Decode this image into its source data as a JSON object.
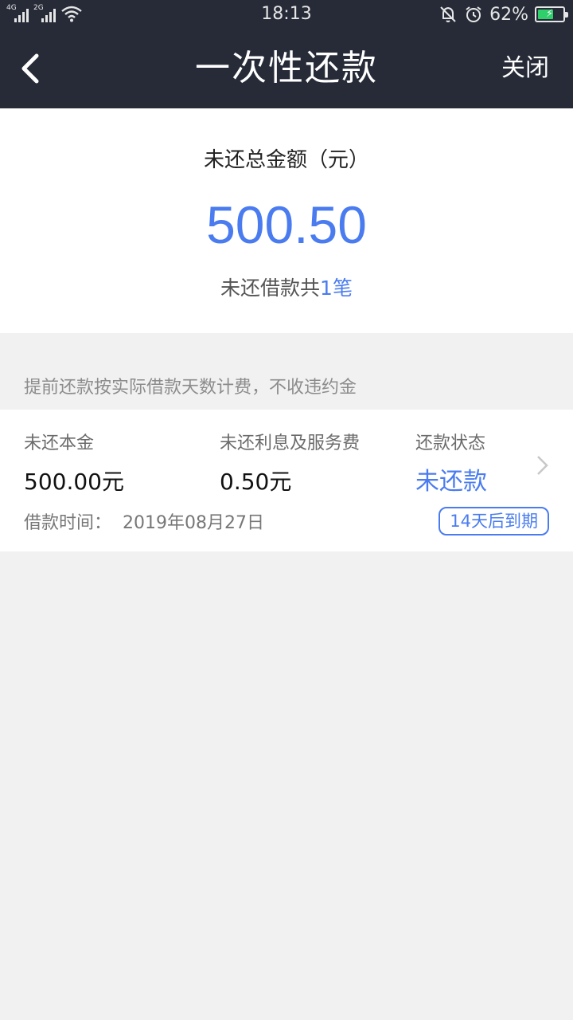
{
  "status_bar": {
    "sim1": "4G",
    "sim2": "2G",
    "time": "18:13",
    "battery": "62%",
    "battery_level": 0.62
  },
  "nav": {
    "title": "一次性还款",
    "close_label": "关闭"
  },
  "summary": {
    "label": "未还总金额（元）",
    "amount": "500.50",
    "count_prefix": "未还借款共",
    "count_value": "1笔"
  },
  "notice": "提前还款按实际借款天数计费，不收违约金",
  "loan": {
    "principal_label": "未还本金",
    "principal_value": "500.00元",
    "fee_label": "未还利息及服务费",
    "fee_value": "0.50元",
    "status_label": "还款状态",
    "status_value": "未还款",
    "date_label": "借款时间：",
    "date_value": "2019年08月27日",
    "due_badge": "14天后到期"
  },
  "colors": {
    "nav_bg": "#272b38",
    "accent": "#4a7cf0",
    "page_bg": "#f1f1f1"
  }
}
